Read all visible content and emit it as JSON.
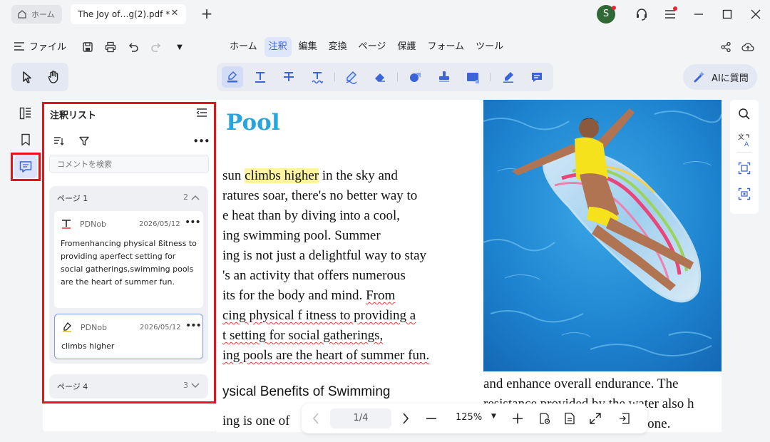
{
  "titlebar": {
    "home_tab_label": "ホーム",
    "doc_tab_label": "The Joy of…g(2).pdf *",
    "avatar_letter": "S"
  },
  "menubar": {
    "file_label": "ファイル",
    "tabs": [
      {
        "label": "ホーム",
        "active": false
      },
      {
        "label": "注釈",
        "active": true
      },
      {
        "label": "編集",
        "active": false
      },
      {
        "label": "変換",
        "active": false
      },
      {
        "label": "ページ",
        "active": false
      },
      {
        "label": "保護",
        "active": false
      },
      {
        "label": "フォーム",
        "active": false
      },
      {
        "label": "ツール",
        "active": false
      }
    ]
  },
  "ai_button": {
    "label": "AIに質問"
  },
  "panel": {
    "title": "注釈リスト",
    "search_placeholder": "コメントを検索",
    "groups": [
      {
        "label": "ページ 1",
        "count": "2",
        "expanded": true,
        "cards": [
          {
            "icon": "text-annotation-icon",
            "user": "PDNob",
            "date": "2026/05/12",
            "text": "Fromenhancing physical ßitness to providing aperfect setting for social gatherings,swimming pools are the heart of summer fun."
          },
          {
            "icon": "highlighter-icon",
            "user": "PDNob",
            "date": "2026/05/12",
            "text": "climbs higher"
          }
        ]
      },
      {
        "label": "ページ 4",
        "count": "3",
        "expanded": false
      }
    ]
  },
  "document": {
    "title": "Pool",
    "lines": [
      {
        "pre": "sun ",
        "hl": "climbs higher",
        "post": " in the sky and"
      },
      {
        "pre": "ratures soar, there's no better way to"
      },
      {
        "pre": "e heat than by diving into a cool,"
      },
      {
        "pre": "ing swimming pool. Summer"
      },
      {
        "pre": "ing is not just a delightful way to stay"
      },
      {
        "pre": "'s an activity that offers numerous"
      },
      {
        "pre": "its for the body and mind. ",
        "sq": "From"
      },
      {
        "sq": "cing physical f  itness to providing a"
      },
      {
        "sq": "t setting for social gatherings,"
      },
      {
        "sq": "ing pools are the heart of summer fun."
      }
    ],
    "heading": "ysical Benefits of Swimming",
    "line_bottom": "ing is one of",
    "right_lines": [
      "and enhance overall endurance. The",
      "resistance provided by the water also h",
      "ch and tone."
    ]
  },
  "bottom_nav": {
    "page_indicator": "1/4",
    "zoom": "125%"
  }
}
